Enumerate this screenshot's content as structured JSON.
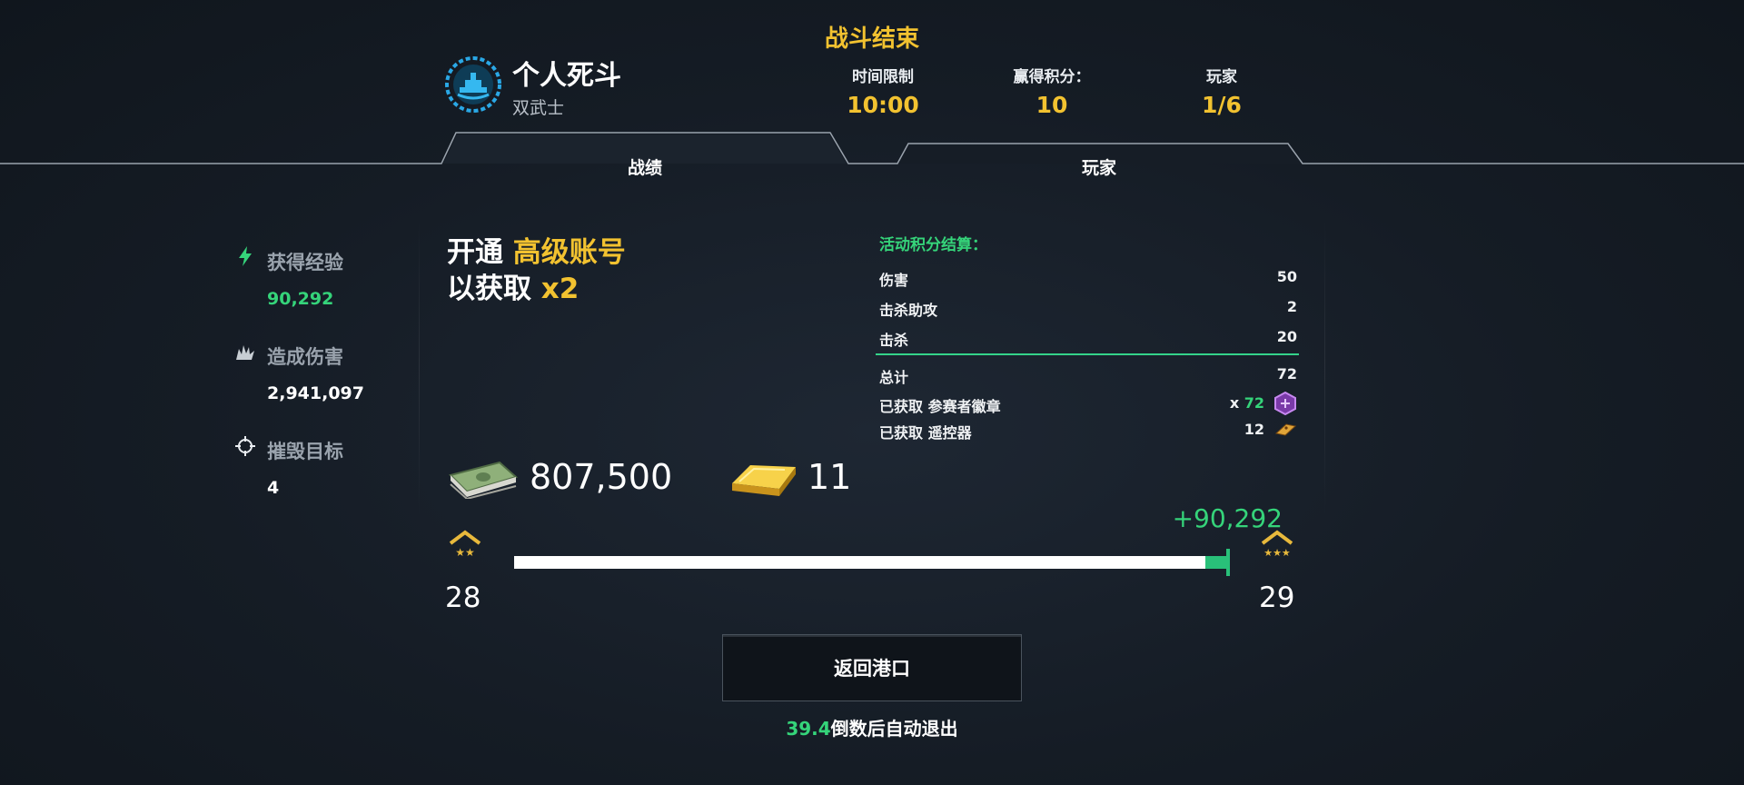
{
  "header": {
    "mode_title": "个人死斗",
    "mode_subtitle": "双武士",
    "battle_end": "战斗结束",
    "stats": [
      {
        "label": "时间限制",
        "value": "10:00"
      },
      {
        "label": "赢得积分：",
        "value": "10"
      },
      {
        "label": "玩家",
        "value": "1/6"
      }
    ],
    "tabs": [
      {
        "label": "战绩",
        "active": true
      },
      {
        "label": "玩家",
        "active": false
      }
    ]
  },
  "left_stats": [
    {
      "icon": "lightning-icon",
      "label": "获得经验",
      "value": "90,292",
      "value_color": "#35d47a"
    },
    {
      "icon": "explosion-icon",
      "label": "造成伤害",
      "value": "2,941,097",
      "value_color": "#ffffff"
    },
    {
      "icon": "crosshair-icon",
      "label": "摧毁目标",
      "value": "4",
      "value_color": "#ffffff"
    }
  ],
  "premium": {
    "line1_prefix": "开通 ",
    "line1_highlight": "高级账号",
    "line2_prefix": "以获取 ",
    "line2_highlight": "x2"
  },
  "event": {
    "title": "活动积分结算：",
    "rows": [
      {
        "label": "伤害",
        "value": "50"
      },
      {
        "label": "击杀助攻",
        "value": "2"
      },
      {
        "label": "击杀",
        "value": "20"
      }
    ],
    "total": {
      "label": "总计",
      "value": "72"
    },
    "rewards": [
      {
        "label": "已获取 参赛者徽章",
        "prefix": "x ",
        "value": "72",
        "icon": "badge-icon"
      },
      {
        "label": "已获取 遥控器",
        "prefix": "",
        "value": "12",
        "icon": "remote-icon"
      }
    ]
  },
  "currency": {
    "cash": "807,500",
    "gold": "11"
  },
  "xp": {
    "gain": "+90,292",
    "level_from": "28",
    "level_to": "29",
    "progress": 1.0
  },
  "actions": {
    "return_label": "返回港口",
    "countdown_value": "39.4",
    "countdown_text": "倒数后自动退出"
  },
  "colors": {
    "accent_gold": "#f2c230",
    "accent_green": "#35d47a",
    "background": "#151c25"
  }
}
